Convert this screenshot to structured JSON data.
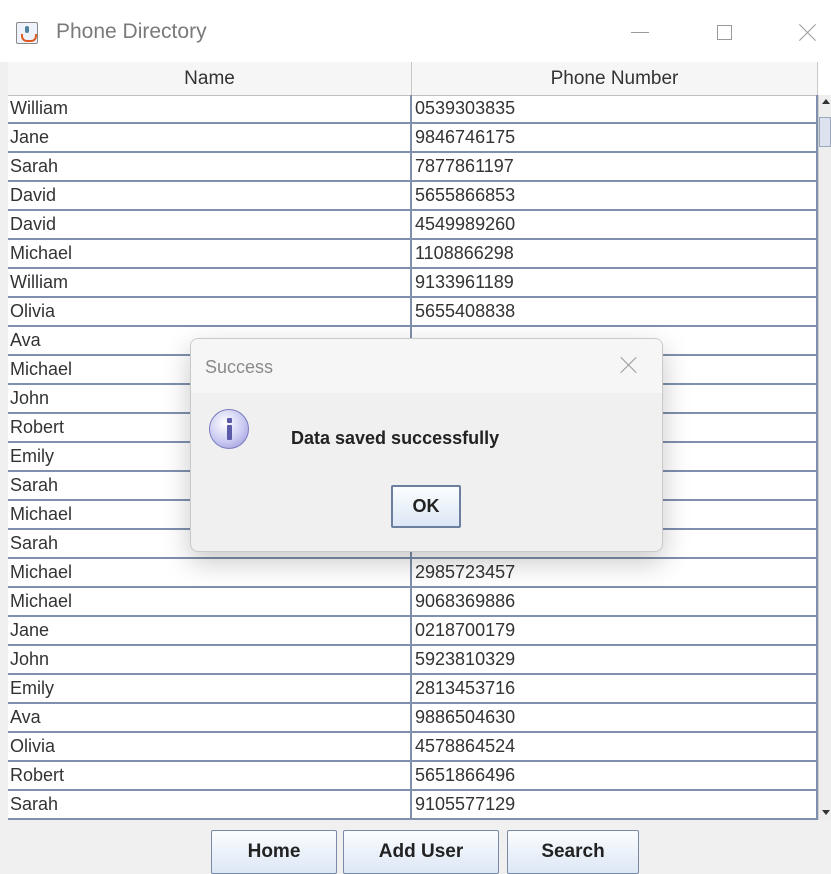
{
  "window": {
    "title": "Phone Directory",
    "icon": "java-cup-icon"
  },
  "table": {
    "columns": [
      "Name",
      "Phone Number"
    ],
    "rows": [
      {
        "name": "William",
        "phone": "0539303835"
      },
      {
        "name": "Jane",
        "phone": "9846746175"
      },
      {
        "name": "Sarah",
        "phone": "7877861197"
      },
      {
        "name": "David",
        "phone": "5655866853"
      },
      {
        "name": "David",
        "phone": "4549989260"
      },
      {
        "name": "Michael",
        "phone": "1108866298"
      },
      {
        "name": "William",
        "phone": "9133961189"
      },
      {
        "name": "Olivia",
        "phone": "5655408838"
      },
      {
        "name": "Ava",
        "phone": ""
      },
      {
        "name": "Michael",
        "phone": ""
      },
      {
        "name": "John",
        "phone": ""
      },
      {
        "name": "Robert",
        "phone": ""
      },
      {
        "name": "Emily",
        "phone": ""
      },
      {
        "name": "Sarah",
        "phone": ""
      },
      {
        "name": "Michael",
        "phone": ""
      },
      {
        "name": "Sarah",
        "phone": ""
      },
      {
        "name": "Michael",
        "phone": "2985723457"
      },
      {
        "name": "Michael",
        "phone": "9068369886"
      },
      {
        "name": "Jane",
        "phone": "0218700179"
      },
      {
        "name": "John",
        "phone": "5923810329"
      },
      {
        "name": "Emily",
        "phone": "2813453716"
      },
      {
        "name": "Ava",
        "phone": "9886504630"
      },
      {
        "name": "Olivia",
        "phone": "4578864524"
      },
      {
        "name": "Robert",
        "phone": "5651866496"
      },
      {
        "name": "Sarah",
        "phone": "9105577129"
      }
    ]
  },
  "buttons": {
    "home": "Home",
    "add_user": "Add User",
    "search": "Search"
  },
  "dialog": {
    "title": "Success",
    "message": "Data saved successfully",
    "ok": "OK",
    "icon": "info-icon"
  },
  "colors": {
    "grid_line": "#7e90ac",
    "button_border": "#7a8aa6",
    "dialog_bg": "#f0f0f0"
  }
}
